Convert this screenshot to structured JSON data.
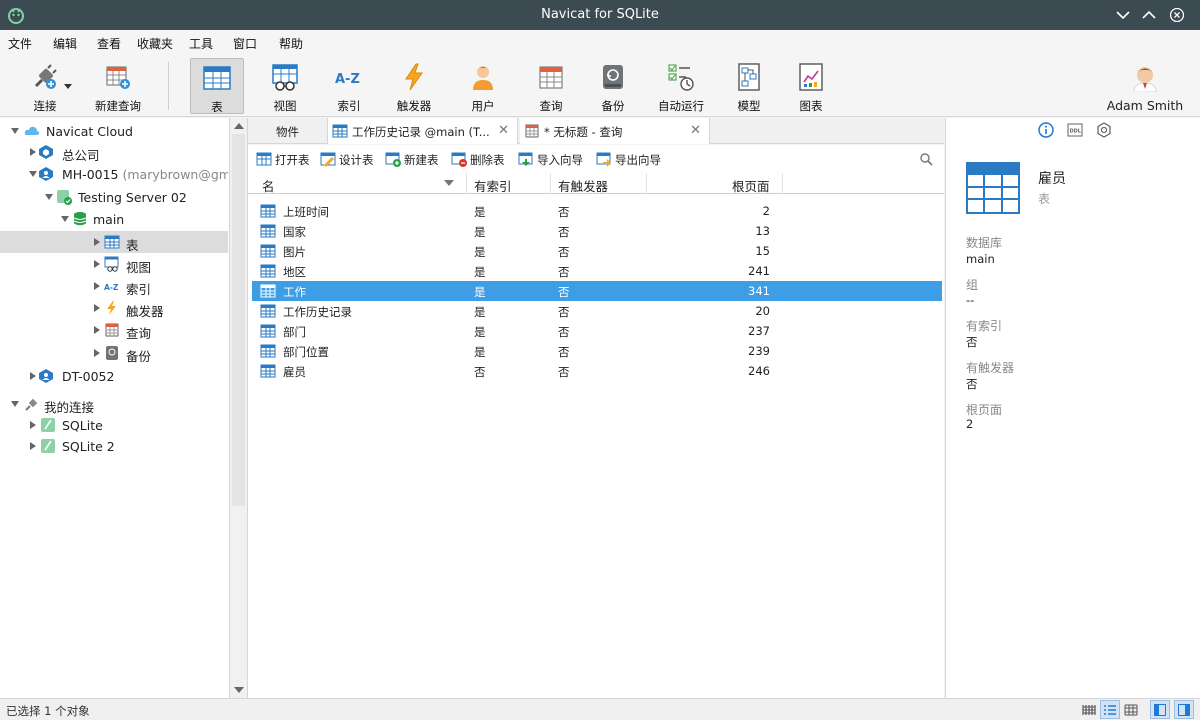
{
  "window": {
    "title": "Navicat for SQLite"
  },
  "menu": [
    "文件",
    "编辑",
    "查看",
    "收藏夹",
    "工具",
    "窗口",
    "帮助"
  ],
  "toolbar": {
    "connect": "连接",
    "new_query": "新建查询",
    "table": "表",
    "view": "视图",
    "index": "索引",
    "trigger": "触发器",
    "user": "用户",
    "query": "查询",
    "backup": "备份",
    "automation": "自动运行",
    "model": "模型",
    "chart": "图表",
    "user_name": "Adam Smith"
  },
  "tree": {
    "navicat_cloud": "Navicat Cloud",
    "head_office": "总公司",
    "mh0015": "MH-0015",
    "mh0015_sub": "(marybrown@gma",
    "testing_server": "Testing Server 02",
    "main_db": "main",
    "tables": "表",
    "views": "视图",
    "indexes": "索引",
    "triggers": "触发器",
    "queries": "查询",
    "backups": "备份",
    "dt0052": "DT-0052",
    "my_connections": "我的连接",
    "sqlite": "SQLite",
    "sqlite2": "SQLite 2"
  },
  "tabs": {
    "objects": "物件",
    "tab1": "工作历史记录 @main (T...",
    "tab2": "* 无标题 - 查询"
  },
  "objbar": {
    "open": "打开表",
    "design": "设计表",
    "new": "新建表",
    "delete": "删除表",
    "import": "导入向导",
    "export": "导出向导"
  },
  "grid": {
    "headers": {
      "name": "名",
      "has_index": "有索引",
      "has_trigger": "有触发器",
      "root_page": "根页面"
    },
    "rows": [
      {
        "name": "上班时间",
        "idx": "是",
        "trg": "否",
        "page": "2"
      },
      {
        "name": "国家",
        "idx": "是",
        "trg": "否",
        "page": "13"
      },
      {
        "name": "图片",
        "idx": "是",
        "trg": "否",
        "page": "15"
      },
      {
        "name": "地区",
        "idx": "是",
        "trg": "否",
        "page": "241"
      },
      {
        "name": "工作",
        "idx": "是",
        "trg": "否",
        "page": "341"
      },
      {
        "name": "工作历史记录",
        "idx": "是",
        "trg": "否",
        "page": "20"
      },
      {
        "name": "部门",
        "idx": "是",
        "trg": "否",
        "page": "237"
      },
      {
        "name": "部门位置",
        "idx": "是",
        "trg": "否",
        "page": "239"
      },
      {
        "name": "雇员",
        "idx": "否",
        "trg": "否",
        "page": "246"
      }
    ]
  },
  "detail": {
    "title": "雇员",
    "subtitle": "表",
    "db_label": "数据库",
    "db_value": "main",
    "group_label": "组",
    "group_value": "--",
    "idx_label": "有索引",
    "idx_value": "否",
    "trg_label": "有触发器",
    "trg_value": "否",
    "page_label": "根页面",
    "page_value": "2"
  },
  "status": {
    "text": "已选择 1 个对象"
  },
  "colors": {
    "titlebar": "#3c4a52",
    "selection": "#3d9ee5",
    "accent": "#1e7ad6"
  }
}
